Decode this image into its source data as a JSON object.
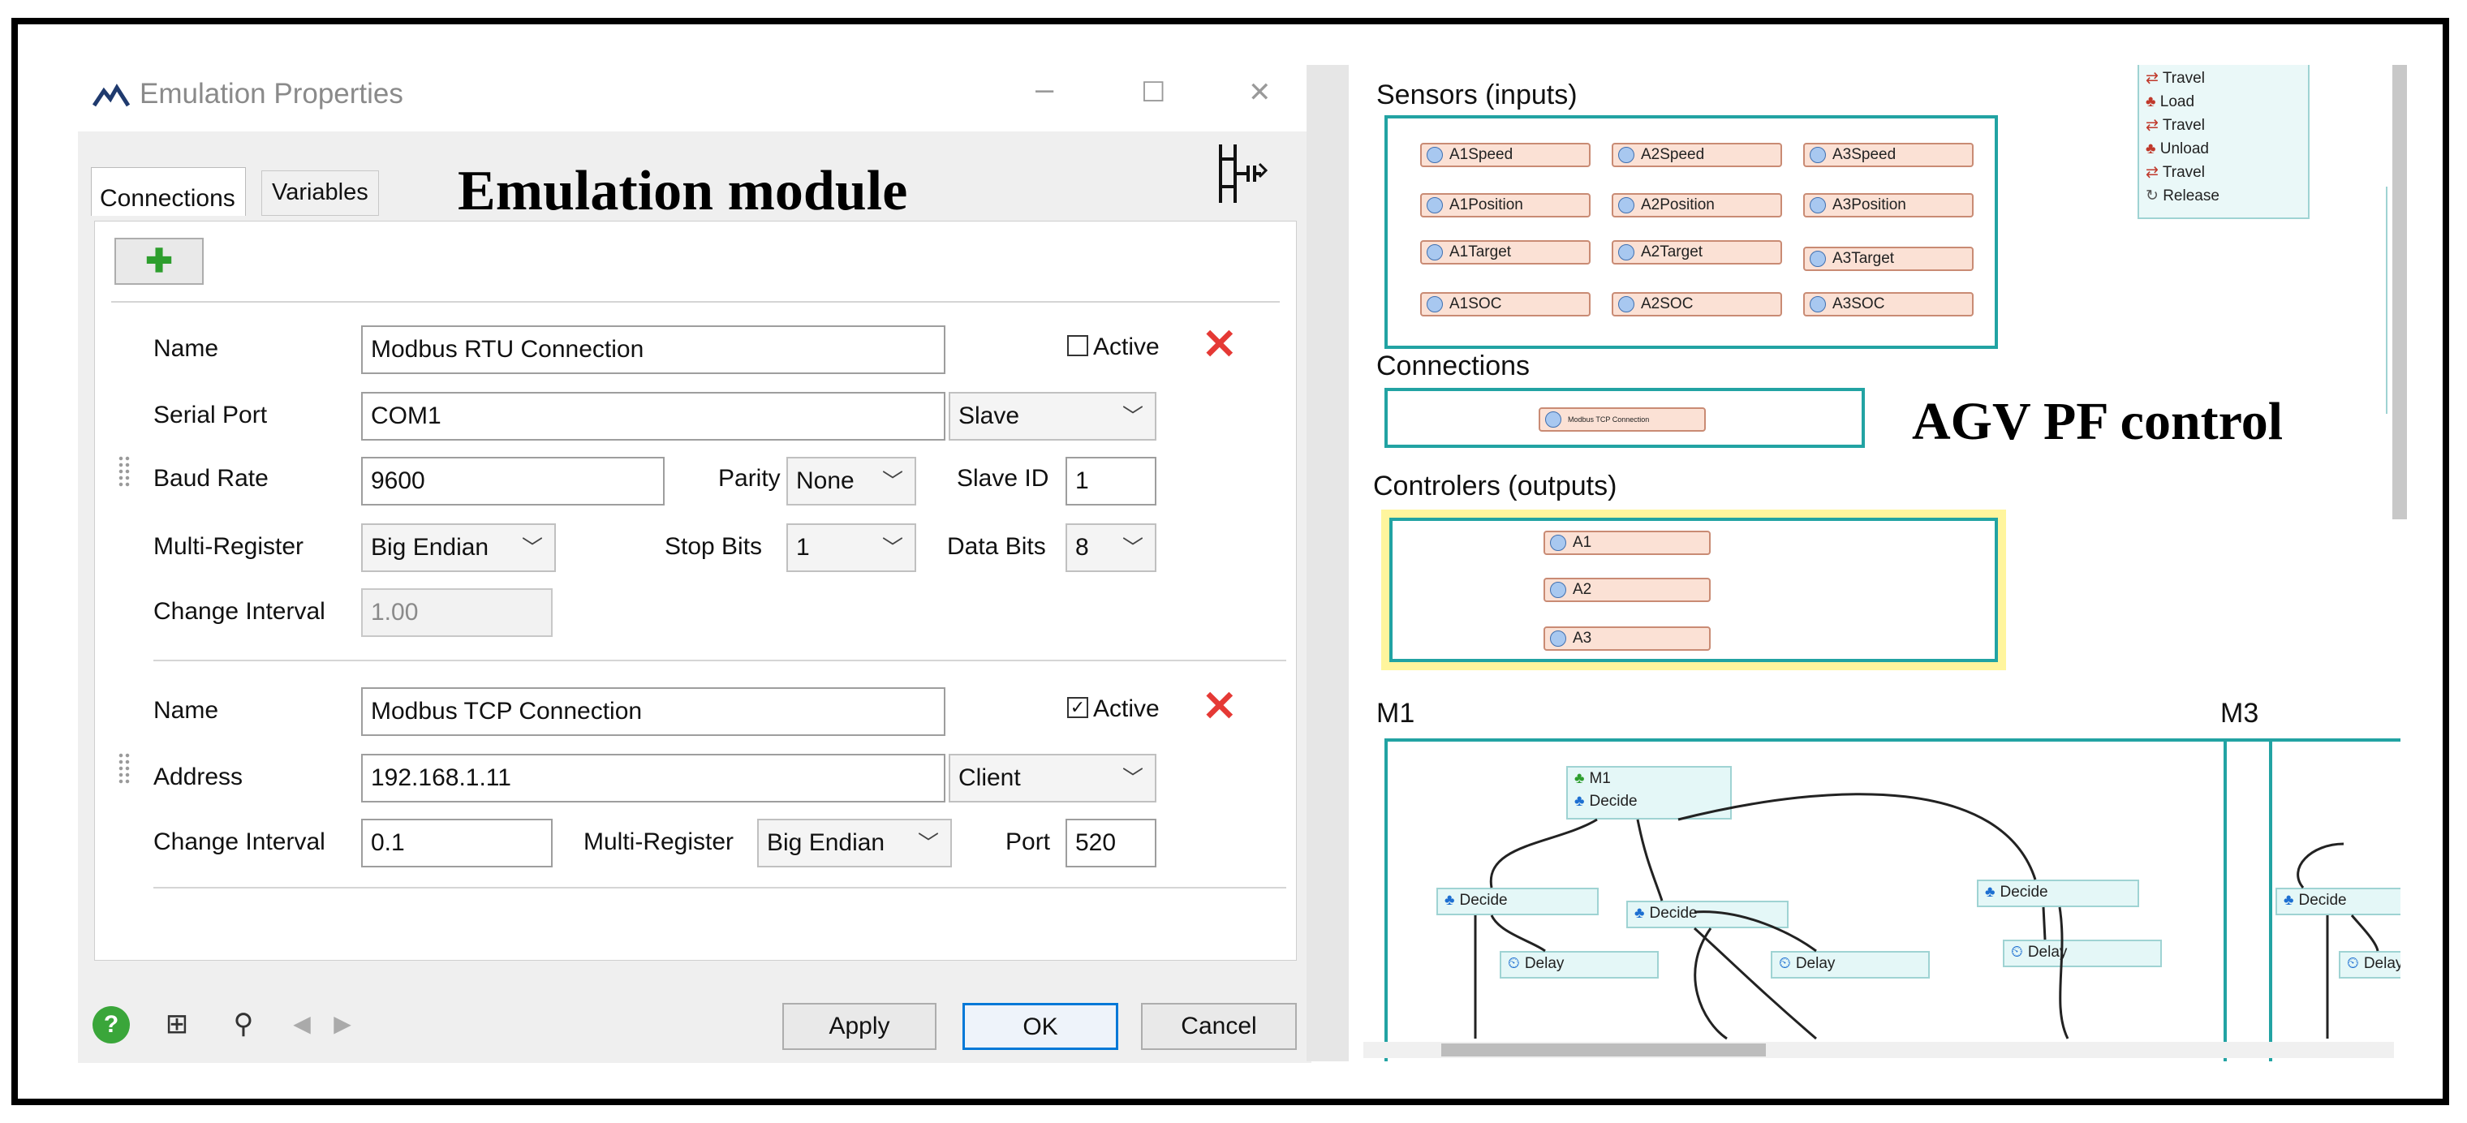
{
  "dialog": {
    "title": "Emulation Properties",
    "minimize": "–",
    "maximize": "☐",
    "close": "✕",
    "tabs": [
      {
        "label": "Connections"
      },
      {
        "label": "Variables"
      }
    ],
    "module_caption": "Emulation module",
    "connection1": {
      "name_label": "Name",
      "name_value": "Modbus RTU Connection",
      "active_label": "Active",
      "active_checked": false,
      "serial_label": "Serial Port",
      "serial_value": "COM1",
      "role_value": "Slave",
      "baud_label": "Baud Rate",
      "baud_value": "9600",
      "parity_label": "Parity",
      "parity_value": "None",
      "slaveid_label": "Slave ID",
      "slaveid_value": "1",
      "multireg_label": "Multi-Register",
      "multireg_value": "Big Endian",
      "stopbits_label": "Stop Bits",
      "stopbits_value": "1",
      "databits_label": "Data Bits",
      "databits_value": "8",
      "interval_label": "Change Interval",
      "interval_value": "1.00"
    },
    "connection2": {
      "name_label": "Name",
      "name_value": "Modbus TCP Connection",
      "active_label": "Active",
      "active_checked": true,
      "address_label": "Address",
      "address_value": "192.168.1.11",
      "role_value": "Client",
      "interval_label": "Change Interval",
      "interval_value": "0.1",
      "multireg_label": "Multi-Register",
      "multireg_value": "Big Endian",
      "port_label": "Port",
      "port_value": "520"
    },
    "buttons": {
      "apply": "Apply",
      "ok": "OK",
      "cancel": "Cancel"
    }
  },
  "right_panel": {
    "caption": "AGV PF control",
    "sensors_title": "Sensors (inputs)",
    "sensors": [
      [
        "A1Speed",
        "A2Speed",
        "A3Speed"
      ],
      [
        "A1Position",
        "A2Position",
        "A3Position"
      ],
      [
        "A1Target",
        "A2Target",
        "A3Target"
      ],
      [
        "A1SOC",
        "A2SOC",
        "A3SOC"
      ]
    ],
    "connections_title": "Connections",
    "connection_item": "Modbus TCP Connection",
    "controllers_title": "Controlers (outputs)",
    "controllers": [
      "A1",
      "A2",
      "A3"
    ],
    "process_steps": [
      "Travel",
      "Load",
      "Travel",
      "Unload",
      "Travel",
      "Release"
    ],
    "m1_title": "M1",
    "m3_title": "M3",
    "flow": {
      "m1_node_title": "M1",
      "decide": "Decide",
      "delay": "Delay"
    }
  },
  "colors": {
    "accent_blue": "#0078d7",
    "teal": "#22a3a3",
    "delete_red": "#e53935",
    "highlight_yellow": "#fff59d"
  }
}
